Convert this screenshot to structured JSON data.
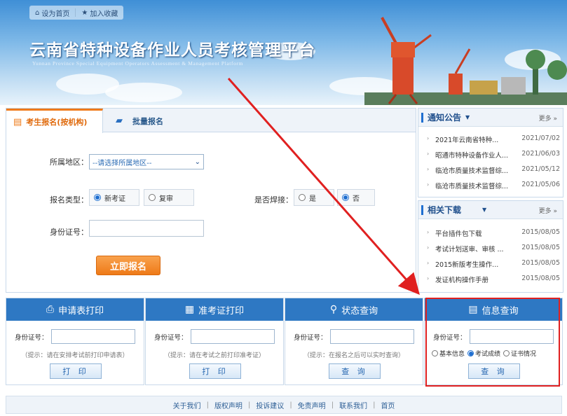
{
  "header": {
    "links": [
      "设为首页",
      "加入收藏"
    ],
    "title": "云南省特种设备作业人员考核管理平台",
    "subtitle": "Yunnan Province Special Equipment Operators Assessment & Management Platform"
  },
  "registration": {
    "tabs": [
      "考生报名(按机构)",
      "批量报名"
    ],
    "region_label": "所属地区：",
    "region_placeholder": "--请选择所属地区--",
    "type_label": "报名类型：",
    "type_options": [
      "新考证",
      "复审"
    ],
    "type_selected": "新考证",
    "weld_label": "是否焊接：",
    "weld_options": [
      "是",
      "否"
    ],
    "weld_selected": "否",
    "id_label": "身份证号：",
    "submit_label": "立即报名"
  },
  "notice": {
    "title": "通知公告",
    "more": "更多",
    "items": [
      {
        "title": "2021年云南省特种...",
        "date": "2021/07/02"
      },
      {
        "title": "昭通市特种设备作业人...",
        "date": "2021/06/03"
      },
      {
        "title": "临沧市质量技术监督综...",
        "date": "2021/05/12"
      },
      {
        "title": "临沧市质量技术监督综...",
        "date": "2021/05/06"
      }
    ]
  },
  "downloads": {
    "title": "相关下载",
    "more": "更多",
    "items": [
      {
        "title": "平台插件包下载",
        "date": "2015/08/05"
      },
      {
        "title": "考试计划送审、审核 ...",
        "date": "2015/08/05"
      },
      {
        "title": "2015新版考生操作...",
        "date": "2015/08/05"
      },
      {
        "title": "发证机构操作手册",
        "date": "2015/08/05"
      }
    ]
  },
  "services": [
    {
      "title": "申请表打印",
      "icon": "printer-icon",
      "label": "身份证号：",
      "hint": "（提示：请在安排考试前打印申请表）",
      "button": "打 印"
    },
    {
      "title": "准考证打印",
      "icon": "calculator-icon",
      "label": "身份证号：",
      "hint": "（提示：请在考试之前打印准考证）",
      "button": "打 印"
    },
    {
      "title": "状态查询",
      "icon": "search-icon",
      "label": "身份证号：",
      "hint": "（提示：在报名之后可以实时查询）",
      "button": "查 询"
    },
    {
      "title": "信息查询",
      "icon": "document-icon",
      "label": "身份证号：",
      "options": [
        "基本信息",
        "考试成绩",
        "证书情况"
      ],
      "selected": "考试成绩",
      "button": "查 询"
    }
  ],
  "footer": [
    "关于我们",
    "版权声明",
    "投诉建议",
    "免责声明",
    "联系我们",
    "首页"
  ],
  "colors": {
    "accent": "#2e78c3",
    "orange": "#ee7a18",
    "annotation": "#e02020"
  }
}
